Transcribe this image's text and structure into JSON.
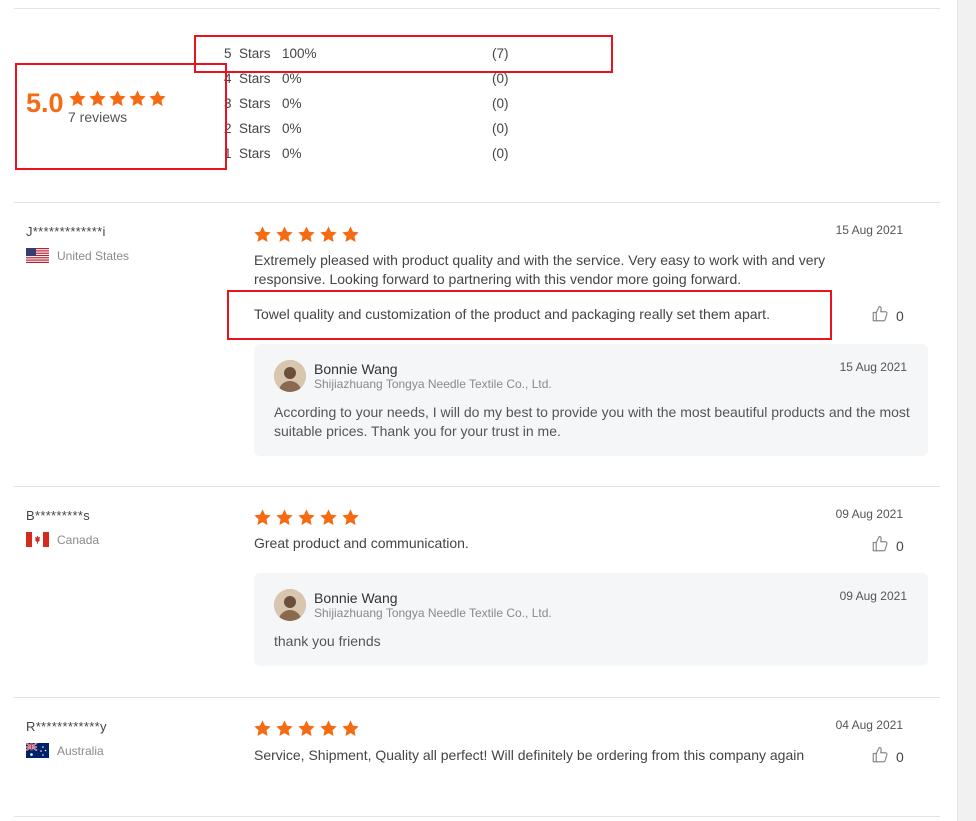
{
  "summary": {
    "score": "5.0",
    "review_count": "7 reviews",
    "distribution": [
      {
        "stars": "5",
        "word": "Stars",
        "percent": "100%",
        "count": "(7)",
        "level": 1.0
      },
      {
        "stars": "4",
        "word": "Stars",
        "percent": "0%",
        "count": "(0)",
        "level": 0
      },
      {
        "stars": "3",
        "word": "Stars",
        "percent": "0%",
        "count": "(0)",
        "level": 0
      },
      {
        "stars": "2",
        "word": "Stars",
        "percent": "0%",
        "count": "(0)",
        "level": 0
      },
      {
        "stars": "1",
        "word": "Stars",
        "percent": "0%",
        "count": "(0)",
        "level": 0
      }
    ]
  },
  "reviews": [
    {
      "name": "J*************i",
      "country": "United States",
      "flag": "us",
      "rating": 5,
      "date": "15 Aug 2021",
      "text": "Extremely pleased with product quality and with the service. Very easy to work with and very responsive. Looking forward to partnering with this vendor more going forward.",
      "text2": "Towel quality and customization of the product and packaging really set them apart.",
      "likes": "0",
      "reply": {
        "name": "Bonnie Wang",
        "company": "Shijiazhuang Tongya Needle Textile Co., Ltd.",
        "date": "15 Aug 2021",
        "text": "According to your needs, I will do my best to provide you with the most beautiful products and the most suitable prices. Thank you for your trust in me."
      }
    },
    {
      "name": "B*********s",
      "country": "Canada",
      "flag": "ca",
      "rating": 5,
      "date": "09 Aug 2021",
      "text": "Great product and communication.",
      "likes": "0",
      "reply": {
        "name": "Bonnie Wang",
        "company": "Shijiazhuang Tongya Needle Textile Co., Ltd.",
        "date": "09 Aug 2021",
        "text": "thank you friends"
      }
    },
    {
      "name": "R************y",
      "country": "Australia",
      "flag": "au",
      "rating": 5,
      "date": "04 Aug 2021",
      "text": "Service, Shipment, Quality all perfect! Will definitely be ordering from this company again",
      "likes": "0"
    }
  ],
  "colors": {
    "star": "#f46b14",
    "score": "#f46b14",
    "highlight_box": "#e8131e",
    "reply_bg": "#f5f6f8"
  },
  "icons": [
    "star-icon",
    "thumbs-up-icon",
    "flag-icon",
    "avatar"
  ]
}
